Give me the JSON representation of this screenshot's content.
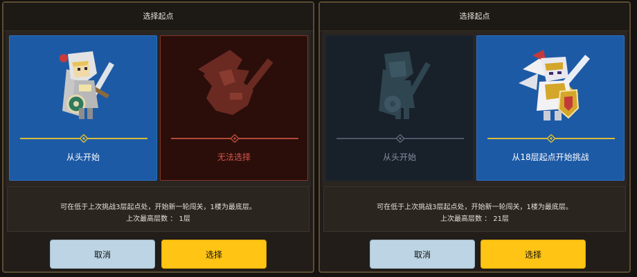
{
  "panels": [
    {
      "title": "选择起点",
      "options": [
        {
          "label": "从头开始",
          "state": "selected",
          "art": "knight-hero-icon"
        },
        {
          "label": "无法选择",
          "state": "unavailable",
          "art": "dragon-knight-silhouette-icon"
        }
      ],
      "info": {
        "line1": "可在低于上次挑战3层起点处，开始新一轮闯关，1楼为最底层。",
        "line2": "上次最高层数 ： 1层"
      },
      "buttons": {
        "cancel": "取消",
        "select": "选择"
      }
    },
    {
      "title": "选择起点",
      "options": [
        {
          "label": "从头开始",
          "state": "unselected",
          "art": "knight-hero-icon"
        },
        {
          "label": "从18层起点开始挑战",
          "state": "selected",
          "art": "dragon-knight-icon"
        }
      ],
      "info": {
        "line1": "可在低于上次挑战3层起点处，开始新一轮闯关，1楼为最底层。",
        "line2": "上次最高层数 ： 21层"
      },
      "buttons": {
        "cancel": "取消",
        "select": "选择"
      }
    }
  ],
  "colors": {
    "selected_card": "#1d5aa6",
    "unavailable_card": "#2b0e0a",
    "unselected_card": "#18202a",
    "select_button": "#ffc414",
    "cancel_button": "#bcd4e3"
  }
}
